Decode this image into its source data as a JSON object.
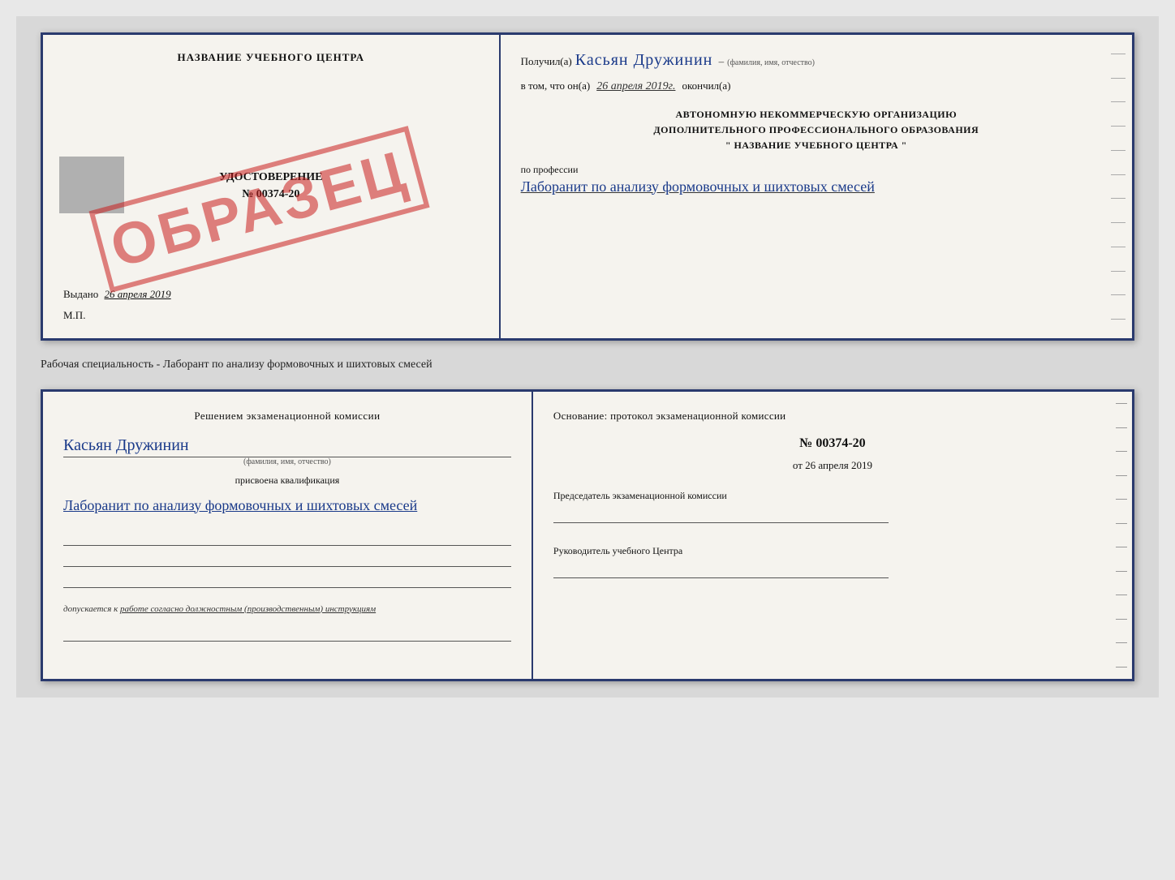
{
  "certificate": {
    "left": {
      "title": "НАЗВАНИЕ УЧЕБНОГО ЦЕНТРА",
      "stamp": "ОБРАЗЕЦ",
      "doc_label": "УДОСТОВЕРЕНИЕ",
      "doc_number": "№ 00374-20",
      "issued_label": "Выдано",
      "issued_date": "26 апреля 2019",
      "mp_label": "М.П."
    },
    "right": {
      "recipient_label": "Получил(а)",
      "recipient_name": "Касьян Дружинин",
      "fio_label": "(фамилия, имя, отчество)",
      "date_prefix": "в том, что он(а)",
      "date_value": "26 апреля 2019г.",
      "date_suffix": "окончил(а)",
      "org_line1": "АВТОНОМНУЮ НЕКОММЕРЧЕСКУЮ ОРГАНИЗАЦИЮ",
      "org_line2": "ДОПОЛНИТЕЛЬНОГО ПРОФЕССИОНАЛЬНОГО ОБРАЗОВАНИЯ",
      "org_line3": "\" НАЗВАНИЕ УЧЕБНОГО ЦЕНТРА \"",
      "profession_label": "по профессии",
      "profession_value": "Лаборанит по анализу формовочных и шихтовых смесей"
    }
  },
  "specialty_text": "Рабочая специальность - Лаборант по анализу формовочных и шихтовых смесей",
  "bottom_doc": {
    "left": {
      "decision_text": "Решением экзаменационной комиссии",
      "name_value": "Касьян Дружинин",
      "fio_label": "(фамилия, имя, отчество)",
      "qualification_label": "присвоена квалификация",
      "qualification_value": "Лаборанит по анализу формовочных и шихтовых смесей",
      "допуск_label": "допускается к",
      "допуск_value": "работе согласно должностным (производственным) инструкциям"
    },
    "right": {
      "osnov_text": "Основание: протокол экзаменационной комиссии",
      "protocol_number": "№ 00374-20",
      "protocol_date_prefix": "от",
      "protocol_date": "26 апреля 2019",
      "chairman_label": "Председатель экзаменационной комиссии",
      "director_label": "Руководитель учебного Центра"
    }
  }
}
